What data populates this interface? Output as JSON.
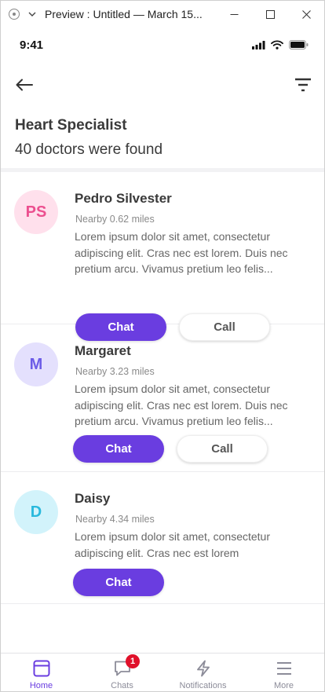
{
  "window": {
    "title": "Preview : Untitled — March 15...",
    "icons": [
      "app-icon",
      "chevron-down-icon",
      "minimize-icon",
      "maximize-icon",
      "close-icon"
    ]
  },
  "status_bar": {
    "time": "9:41",
    "icons": [
      "signal-icon",
      "wifi-icon",
      "battery-icon"
    ]
  },
  "header": {
    "icons": [
      "back-arrow-icon",
      "filter-icon"
    ],
    "title": "Heart Specialist",
    "subtitle": "40 doctors were found"
  },
  "doctors": [
    {
      "initials": "PS",
      "name": "Pedro Silvester",
      "distance": "Nearby 0.62 miles",
      "description": "Lorem ipsum dolor sit amet, consectetur adipiscing elit. Cras nec est lorem. Duis nec pretium arcu. Vivamus pretium leo felis...",
      "chat_label": "Chat",
      "call_label": "Call",
      "avatar_bg": "#ffe0ec",
      "avatar_fg": "#ec4f8f"
    },
    {
      "initials": "M",
      "name": "Margaret",
      "distance": "Nearby 3.23 miles",
      "description": "Lorem ipsum dolor sit amet, consectetur adipiscing elit. Cras nec est lorem. Duis nec pretium arcu. Vivamus pretium leo felis...",
      "chat_label": "Chat",
      "call_label": "Call",
      "avatar_bg": "#e4e0fd",
      "avatar_fg": "#6c5ce7"
    },
    {
      "initials": "D",
      "name": "Daisy",
      "distance": "Nearby 4.34 miles",
      "description": "Lorem ipsum dolor sit amet, consectetur adipiscing elit. Cras nec est lorem",
      "chat_label": "Chat",
      "avatar_bg": "#d2f3fb",
      "avatar_fg": "#29b9dd"
    }
  ],
  "tab_bar": {
    "tabs": [
      {
        "label": "Home",
        "icon": "home-icon",
        "active": true
      },
      {
        "label": "Chats",
        "icon": "chat-bubble-icon",
        "badge": "1"
      },
      {
        "label": "Notifications",
        "icon": "lightning-icon"
      },
      {
        "label": "More",
        "icon": "menu-icon"
      }
    ]
  },
  "colors": {
    "accent": "#6a3de0",
    "badge": "#e0102a",
    "inactive_tab": "#8c8c99"
  }
}
